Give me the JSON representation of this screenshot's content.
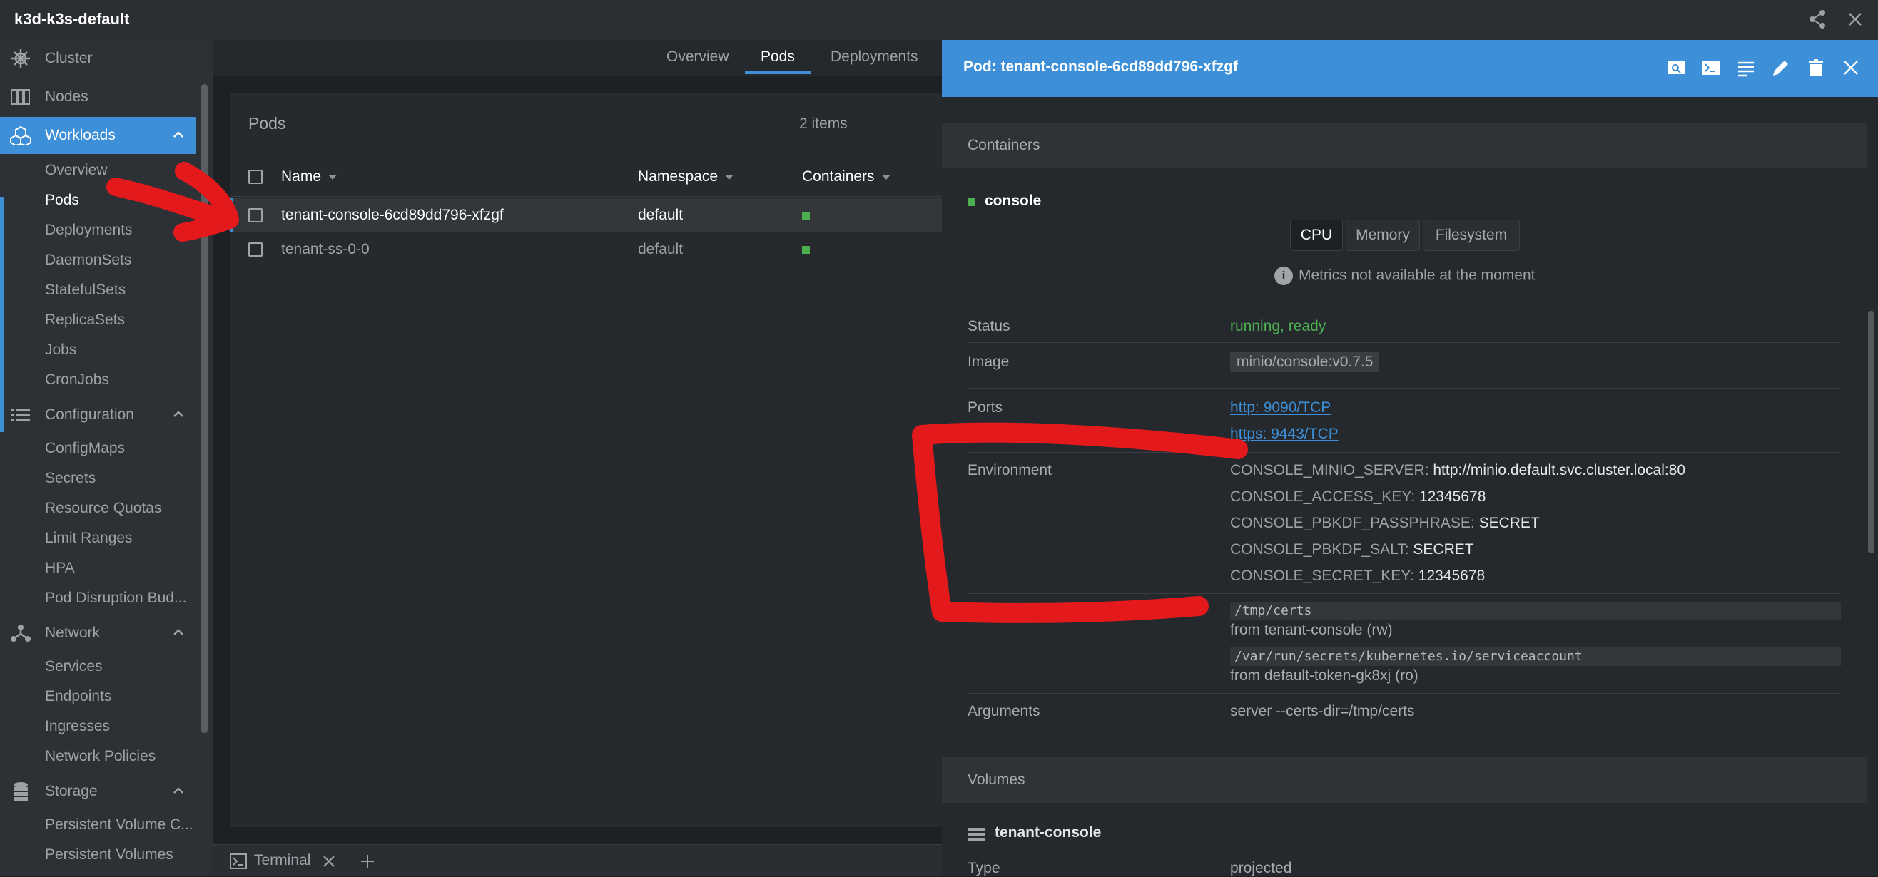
{
  "app": {
    "title": "k3d-k3s-default"
  },
  "topbar": {
    "share_icon": "share-icon",
    "close_icon": "close-icon"
  },
  "sidebar": {
    "cluster": "Cluster",
    "nodes": "Nodes",
    "workloads": "Workloads",
    "workloads_items": [
      "Overview",
      "Pods",
      "Deployments",
      "DaemonSets",
      "StatefulSets",
      "ReplicaSets",
      "Jobs",
      "CronJobs"
    ],
    "configuration": "Configuration",
    "configuration_items": [
      "ConfigMaps",
      "Secrets",
      "Resource Quotas",
      "Limit Ranges",
      "HPA",
      "Pod Disruption Bud..."
    ],
    "network": "Network",
    "network_items": [
      "Services",
      "Endpoints",
      "Ingresses",
      "Network Policies"
    ],
    "storage": "Storage",
    "storage_items": [
      "Persistent Volume C...",
      "Persistent Volumes"
    ]
  },
  "main": {
    "tabs": [
      "Overview",
      "Pods",
      "Deployments"
    ],
    "panel_title": "Pods",
    "count": "2 items",
    "columns": [
      "Name",
      "Namespace",
      "Containers"
    ],
    "rows": [
      {
        "name": "tenant-console-6cd89dd796-xfzgf",
        "namespace": "default"
      },
      {
        "name": "tenant-ss-0-0",
        "namespace": "default"
      }
    ]
  },
  "terminal": {
    "label": "Terminal"
  },
  "drawer": {
    "title": "Pod: tenant-console-6cd89dd796-xfzgf",
    "containers_header": "Containers",
    "container_name": "console",
    "metric_tabs": [
      "CPU",
      "Memory",
      "Filesystem"
    ],
    "metrics_note": "Metrics not available at the moment",
    "status_label": "Status",
    "status_value": "running, ready",
    "image_label": "Image",
    "image_value": "minio/console:v0.7.5",
    "ports_label": "Ports",
    "ports": [
      "http: 9090/TCP",
      "https: 9443/TCP"
    ],
    "env_label": "Environment",
    "env": [
      {
        "key": "CONSOLE_MINIO_SERVER:",
        "value": "http://minio.default.svc.cluster.local:80"
      },
      {
        "key": "CONSOLE_ACCESS_KEY:",
        "value": "12345678"
      },
      {
        "key": "CONSOLE_PBKDF_PASSPHRASE:",
        "value": "SECRET"
      },
      {
        "key": "CONSOLE_PBKDF_SALT:",
        "value": "SECRET"
      },
      {
        "key": "CONSOLE_SECRET_KEY:",
        "value": "12345678"
      }
    ],
    "mounts": [
      {
        "path": "/tmp/certs",
        "from": "from tenant-console (rw)"
      },
      {
        "path": "/var/run/secrets/kubernetes.io/serviceaccount",
        "from": "from default-token-gk8xj (ro)"
      }
    ],
    "args_label": "Arguments",
    "args_value": "server --certs-dir=/tmp/certs",
    "volumes_header": "Volumes",
    "volume_name": "tenant-console",
    "type_label": "Type",
    "type_value": "projected"
  },
  "colors": {
    "accent": "#3d8fd8",
    "ok": "#4caf50",
    "annotation": "#e3191c"
  }
}
